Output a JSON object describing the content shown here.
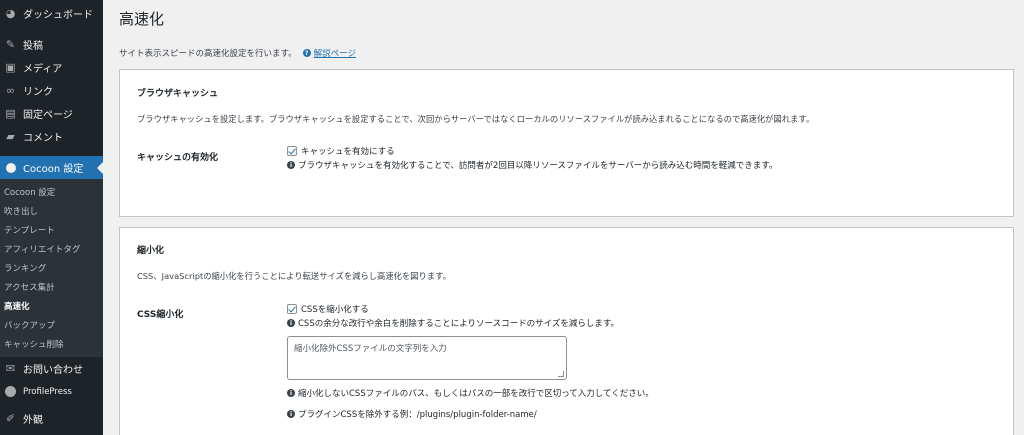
{
  "sidebar": {
    "items": [
      {
        "label": "ダッシュボード",
        "icon": "dashboard-icon"
      },
      {
        "label": "投稿",
        "icon": "pin-icon"
      },
      {
        "label": "メディア",
        "icon": "media-icon"
      },
      {
        "label": "リンク",
        "icon": "link-icon"
      },
      {
        "label": "固定ページ",
        "icon": "page-icon"
      },
      {
        "label": "コメント",
        "icon": "comment-icon"
      },
      {
        "label": "Cocoon 設定",
        "icon": "cocoon-icon"
      }
    ],
    "submenu": [
      {
        "label": "Cocoon 設定"
      },
      {
        "label": "吹き出し"
      },
      {
        "label": "テンプレート"
      },
      {
        "label": "アフィリエイトタグ"
      },
      {
        "label": "ランキング"
      },
      {
        "label": "アクセス集計"
      },
      {
        "label": "高速化"
      },
      {
        "label": "バックアップ"
      },
      {
        "label": "キャッシュ削除"
      }
    ],
    "after": [
      {
        "label": "お問い合わせ",
        "icon": "mail-icon"
      },
      {
        "label": "ProfilePress",
        "icon": "profilepress-icon"
      },
      {
        "label": "外観",
        "icon": "appearance-icon"
      }
    ]
  },
  "page": {
    "title": "高速化",
    "intro": "サイト表示スピードの高速化設定を行います。",
    "help_link": "解説ページ"
  },
  "browser_cache": {
    "title": "ブラウザキャッシュ",
    "description": "ブラウザキャッシュを設定します。ブラウザキャッシュを設定することで、次回からサーバーではなくローカルのリソースファイルが読み込まれることになるので高速化が図れます。",
    "label": "キャッシュの有効化",
    "checkbox_label": "キャッシュを有効にする",
    "checked": true,
    "note": "ブラウザキャッシュを有効化することで、訪問者が2回目以降リソースファイルをサーバーから読み込む時間を軽減できます。"
  },
  "minify": {
    "title": "縮小化",
    "description": "CSS、JavaScriptの縮小化を行うことにより転送サイズを減らし高速化を図ります。",
    "css_label": "CSS縮小化",
    "css_checkbox_label": "CSSを縮小化する",
    "css_checked": true,
    "css_note": "CSSの余分な改行や余白を削除することによりソースコードのサイズを減らします。",
    "exclude_placeholder": "縮小化除外CSSファイルの文字列を入力",
    "exclude_note": "縮小化しないCSSファイルのパス、もしくはパスの一部を改行で区切って入力してください。",
    "plugin_note": "プラグインCSSを除外する例：/plugins/plugin-folder-name/"
  },
  "colors": {
    "sidebar_bg": "#1d2327",
    "active_bg": "#2271b1",
    "link": "#2271b1"
  }
}
